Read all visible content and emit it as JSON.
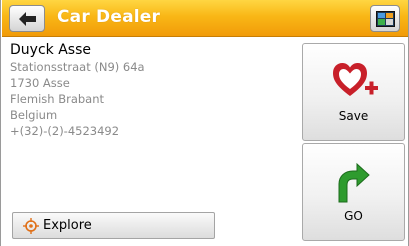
{
  "header": {
    "title": "Car Dealer",
    "back_icon": "back-arrow-icon",
    "map_icon": "map-view-icon",
    "color_top": "#ffd642",
    "color_bottom": "#f19b09"
  },
  "place": {
    "name": "Duyck Asse",
    "address_lines": [
      "Stationsstraat (N9) 64a",
      "1730 Asse",
      "Flemish Brabant",
      "Belgium",
      "+(32)-(2)-4523492"
    ]
  },
  "actions": {
    "explore_label": "Explore",
    "explore_icon": "crosshair-target-icon",
    "save_label": "Save",
    "save_icon": "heart-plus-icon",
    "go_label": "GO",
    "go_icon": "turn-arrow-icon",
    "heart_color": "#c8202a",
    "go_arrow_color": "#2e9b2e"
  }
}
